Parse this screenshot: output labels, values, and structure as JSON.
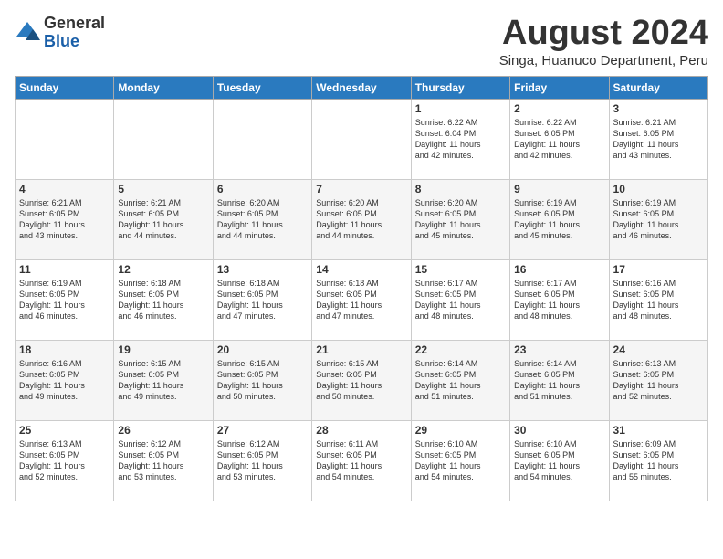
{
  "logo": {
    "general": "General",
    "blue": "Blue"
  },
  "title": "August 2024",
  "subtitle": "Singa, Huanuco Department, Peru",
  "days_of_week": [
    "Sunday",
    "Monday",
    "Tuesday",
    "Wednesday",
    "Thursday",
    "Friday",
    "Saturday"
  ],
  "weeks": [
    [
      {
        "day": "",
        "info": ""
      },
      {
        "day": "",
        "info": ""
      },
      {
        "day": "",
        "info": ""
      },
      {
        "day": "",
        "info": ""
      },
      {
        "day": "1",
        "info": "Sunrise: 6:22 AM\nSunset: 6:04 PM\nDaylight: 11 hours\nand 42 minutes."
      },
      {
        "day": "2",
        "info": "Sunrise: 6:22 AM\nSunset: 6:05 PM\nDaylight: 11 hours\nand 42 minutes."
      },
      {
        "day": "3",
        "info": "Sunrise: 6:21 AM\nSunset: 6:05 PM\nDaylight: 11 hours\nand 43 minutes."
      }
    ],
    [
      {
        "day": "4",
        "info": "Sunrise: 6:21 AM\nSunset: 6:05 PM\nDaylight: 11 hours\nand 43 minutes."
      },
      {
        "day": "5",
        "info": "Sunrise: 6:21 AM\nSunset: 6:05 PM\nDaylight: 11 hours\nand 44 minutes."
      },
      {
        "day": "6",
        "info": "Sunrise: 6:20 AM\nSunset: 6:05 PM\nDaylight: 11 hours\nand 44 minutes."
      },
      {
        "day": "7",
        "info": "Sunrise: 6:20 AM\nSunset: 6:05 PM\nDaylight: 11 hours\nand 44 minutes."
      },
      {
        "day": "8",
        "info": "Sunrise: 6:20 AM\nSunset: 6:05 PM\nDaylight: 11 hours\nand 45 minutes."
      },
      {
        "day": "9",
        "info": "Sunrise: 6:19 AM\nSunset: 6:05 PM\nDaylight: 11 hours\nand 45 minutes."
      },
      {
        "day": "10",
        "info": "Sunrise: 6:19 AM\nSunset: 6:05 PM\nDaylight: 11 hours\nand 46 minutes."
      }
    ],
    [
      {
        "day": "11",
        "info": "Sunrise: 6:19 AM\nSunset: 6:05 PM\nDaylight: 11 hours\nand 46 minutes."
      },
      {
        "day": "12",
        "info": "Sunrise: 6:18 AM\nSunset: 6:05 PM\nDaylight: 11 hours\nand 46 minutes."
      },
      {
        "day": "13",
        "info": "Sunrise: 6:18 AM\nSunset: 6:05 PM\nDaylight: 11 hours\nand 47 minutes."
      },
      {
        "day": "14",
        "info": "Sunrise: 6:18 AM\nSunset: 6:05 PM\nDaylight: 11 hours\nand 47 minutes."
      },
      {
        "day": "15",
        "info": "Sunrise: 6:17 AM\nSunset: 6:05 PM\nDaylight: 11 hours\nand 48 minutes."
      },
      {
        "day": "16",
        "info": "Sunrise: 6:17 AM\nSunset: 6:05 PM\nDaylight: 11 hours\nand 48 minutes."
      },
      {
        "day": "17",
        "info": "Sunrise: 6:16 AM\nSunset: 6:05 PM\nDaylight: 11 hours\nand 48 minutes."
      }
    ],
    [
      {
        "day": "18",
        "info": "Sunrise: 6:16 AM\nSunset: 6:05 PM\nDaylight: 11 hours\nand 49 minutes."
      },
      {
        "day": "19",
        "info": "Sunrise: 6:15 AM\nSunset: 6:05 PM\nDaylight: 11 hours\nand 49 minutes."
      },
      {
        "day": "20",
        "info": "Sunrise: 6:15 AM\nSunset: 6:05 PM\nDaylight: 11 hours\nand 50 minutes."
      },
      {
        "day": "21",
        "info": "Sunrise: 6:15 AM\nSunset: 6:05 PM\nDaylight: 11 hours\nand 50 minutes."
      },
      {
        "day": "22",
        "info": "Sunrise: 6:14 AM\nSunset: 6:05 PM\nDaylight: 11 hours\nand 51 minutes."
      },
      {
        "day": "23",
        "info": "Sunrise: 6:14 AM\nSunset: 6:05 PM\nDaylight: 11 hours\nand 51 minutes."
      },
      {
        "day": "24",
        "info": "Sunrise: 6:13 AM\nSunset: 6:05 PM\nDaylight: 11 hours\nand 52 minutes."
      }
    ],
    [
      {
        "day": "25",
        "info": "Sunrise: 6:13 AM\nSunset: 6:05 PM\nDaylight: 11 hours\nand 52 minutes."
      },
      {
        "day": "26",
        "info": "Sunrise: 6:12 AM\nSunset: 6:05 PM\nDaylight: 11 hours\nand 53 minutes."
      },
      {
        "day": "27",
        "info": "Sunrise: 6:12 AM\nSunset: 6:05 PM\nDaylight: 11 hours\nand 53 minutes."
      },
      {
        "day": "28",
        "info": "Sunrise: 6:11 AM\nSunset: 6:05 PM\nDaylight: 11 hours\nand 54 minutes."
      },
      {
        "day": "29",
        "info": "Sunrise: 6:10 AM\nSunset: 6:05 PM\nDaylight: 11 hours\nand 54 minutes."
      },
      {
        "day": "30",
        "info": "Sunrise: 6:10 AM\nSunset: 6:05 PM\nDaylight: 11 hours\nand 54 minutes."
      },
      {
        "day": "31",
        "info": "Sunrise: 6:09 AM\nSunset: 6:05 PM\nDaylight: 11 hours\nand 55 minutes."
      }
    ]
  ]
}
